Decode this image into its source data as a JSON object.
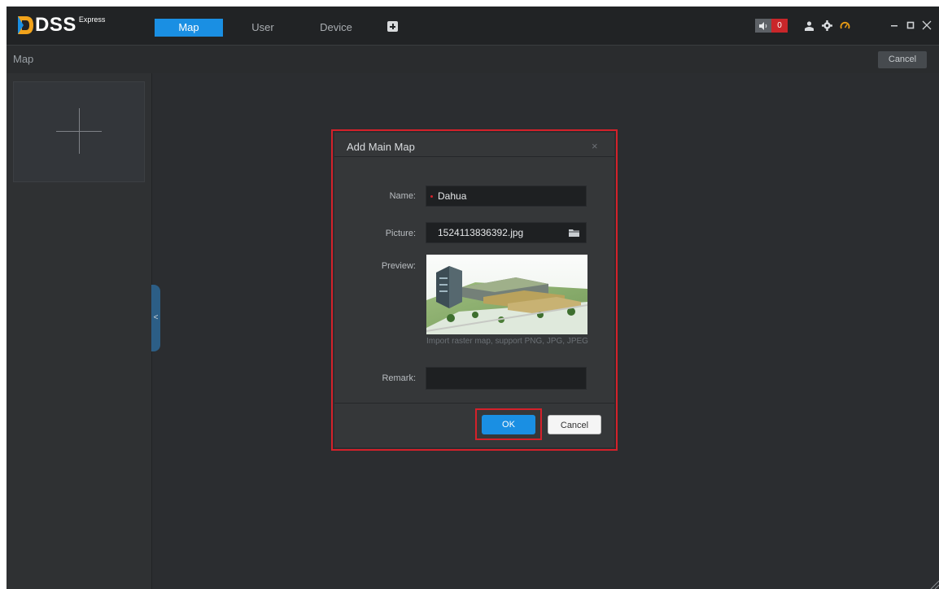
{
  "app": {
    "logo_text": "DSS",
    "logo_sup": "Express"
  },
  "nav": {
    "tabs": [
      {
        "label": "Map",
        "active": true
      },
      {
        "label": "User",
        "active": false
      },
      {
        "label": "Device",
        "active": false
      }
    ],
    "add_icon": "plus-square-icon"
  },
  "toolbar": {
    "alarm_count": "0",
    "icons": [
      "speaker-icon",
      "user-icon",
      "gear-icon",
      "gauge-icon"
    ],
    "window_controls": [
      "minimize-icon",
      "maximize-icon",
      "close-icon"
    ]
  },
  "subheader": {
    "title": "Map",
    "cancel_label": "Cancel"
  },
  "sidebar": {
    "add_map_icon": "plus-icon",
    "collapse_glyph": "<"
  },
  "dialog": {
    "title": "Add Main Map",
    "close_glyph": "×",
    "name_label": "Name:",
    "name_value": "Dahua",
    "picture_label": "Picture:",
    "picture_value": "1524113836392.jpg",
    "preview_label": "Preview:",
    "hint": "Import raster map, support PNG, JPG, JPEG",
    "remark_label": "Remark:",
    "remark_value": "",
    "ok_label": "OK",
    "cancel_label": "Cancel"
  },
  "colors": {
    "accent": "#1a8fe3",
    "highlight": "#d4212a",
    "background": "#2b2d30",
    "alarm": "#c9262a"
  }
}
